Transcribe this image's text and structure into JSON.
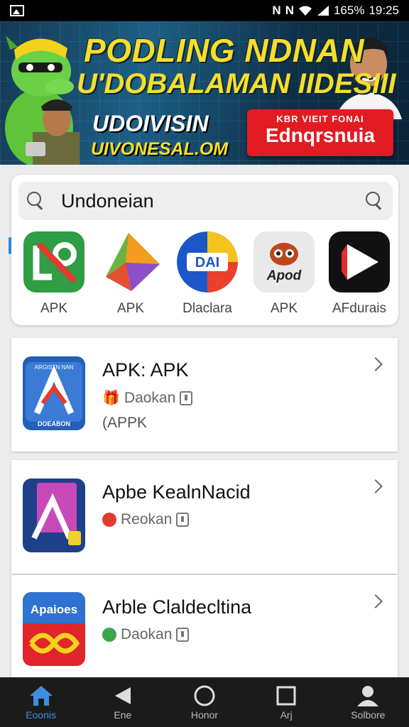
{
  "status_bar": {
    "network": "N",
    "battery": "165%",
    "time": "19:25"
  },
  "banner": {
    "headline1": "PODLING NDNAN",
    "headline2": "U'DOBALAMAN IIDESIII",
    "sub1": "UDOIVISIN",
    "sub2": "UIVONESAL.OM",
    "cta_small": "KBR VIEIT FONAI",
    "cta_big": "Ednqrsnuia"
  },
  "search": {
    "query": "Undoneian"
  },
  "apps": [
    {
      "label": "APK",
      "icon": "green-pencil-icon"
    },
    {
      "label": "APK",
      "icon": "colorful-arrow-icon"
    },
    {
      "label": "Dlaclara",
      "icon": "dai-icon"
    },
    {
      "label": "APK",
      "icon": "apod-owl-icon"
    },
    {
      "label": "AFdurais",
      "icon": "play-icon"
    }
  ],
  "list": [
    {
      "title": "APK: APK",
      "meta": "Daokan",
      "sub": "(APPK",
      "icon_caption_top": "ARGISTN NAN",
      "icon_caption_bottom": "DOEABON"
    },
    {
      "title": "Apbe KealnNacid",
      "meta": "Reokan",
      "sub": ""
    },
    {
      "title": "Arble Claldecltina",
      "meta": "Daokan",
      "sub": "",
      "icon_caption": "Apaioes"
    }
  ],
  "bottom_nav": [
    {
      "label": "Eoonis",
      "icon": "home-icon",
      "active": true
    },
    {
      "label": "Ene",
      "icon": "back-icon",
      "active": false
    },
    {
      "label": "Honor",
      "icon": "circle-icon",
      "active": false
    },
    {
      "label": "Arj",
      "icon": "square-icon",
      "active": false
    },
    {
      "label": "Solbore",
      "icon": "person-icon",
      "active": false
    }
  ],
  "colors": {
    "accent": "#3d8fe0",
    "banner_yellow": "#f6de2a",
    "cta_red": "#e21b23"
  }
}
